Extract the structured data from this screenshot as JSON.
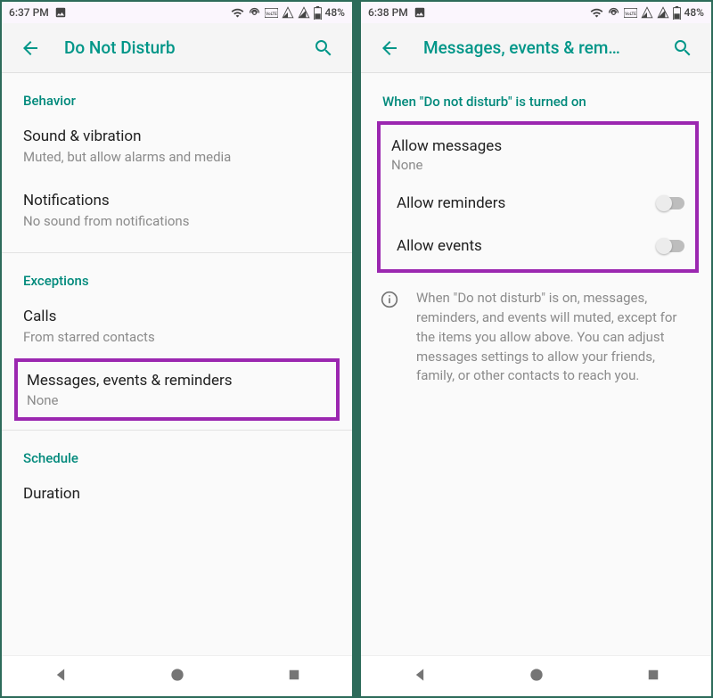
{
  "colors": {
    "accent": "#009688",
    "highlight": "#9b27b0"
  },
  "left": {
    "status": {
      "time": "6:37 PM",
      "battery": "48%"
    },
    "appbar": {
      "title": "Do Not Disturb"
    },
    "sections": {
      "behavior": {
        "header": "Behavior",
        "sound": {
          "title": "Sound & vibration",
          "subtitle": "Muted, but allow alarms and media"
        },
        "notifications": {
          "title": "Notifications",
          "subtitle": "No sound from notifications"
        }
      },
      "exceptions": {
        "header": "Exceptions",
        "calls": {
          "title": "Calls",
          "subtitle": "From starred contacts"
        },
        "messages": {
          "title": "Messages, events & reminders",
          "subtitle": "None"
        }
      },
      "schedule": {
        "header": "Schedule",
        "duration": {
          "title": "Duration"
        }
      }
    }
  },
  "right": {
    "status": {
      "time": "6:38 PM",
      "battery": "48%"
    },
    "appbar": {
      "title": "Messages, events & rem…"
    },
    "header": "When \"Do not disturb\" is turned on",
    "allow_messages": {
      "title": "Allow messages",
      "subtitle": "None"
    },
    "allow_reminders": {
      "title": "Allow reminders",
      "on": false
    },
    "allow_events": {
      "title": "Allow events",
      "on": false
    },
    "info": "When \"Do not disturb\" is on, messages, reminders, and events will muted, except for the items you allow above. You can adjust messages settings to allow your friends, family, or other contacts to reach you."
  }
}
